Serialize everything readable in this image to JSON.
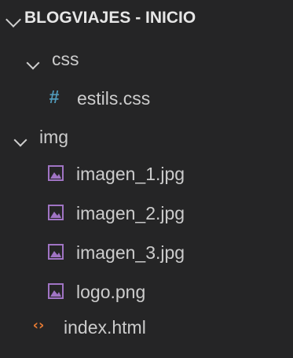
{
  "explorer": {
    "title": "BLOGVIAJES - INICIO",
    "items": [
      {
        "label": "css",
        "type": "folder",
        "expanded": true,
        "icon": "chevron-down-icon"
      },
      {
        "label": "estils.css",
        "type": "file",
        "icon": "css-hash-icon"
      },
      {
        "label": "img",
        "type": "folder",
        "expanded": true,
        "icon": "chevron-down-icon"
      },
      {
        "label": "imagen_1.jpg",
        "type": "file",
        "icon": "image-file-icon"
      },
      {
        "label": "imagen_2.jpg",
        "type": "file",
        "icon": "image-file-icon"
      },
      {
        "label": "imagen_3.jpg",
        "type": "file",
        "icon": "image-file-icon"
      },
      {
        "label": "logo.png",
        "type": "file",
        "icon": "image-file-icon"
      },
      {
        "label": "index.html",
        "type": "file",
        "icon": "html-brackets-icon"
      }
    ]
  },
  "colors": {
    "background": "#252526",
    "text": "#cccccc",
    "css_icon": "#519aba",
    "image_icon": "#a074c4",
    "html_icon": "#e37933"
  }
}
